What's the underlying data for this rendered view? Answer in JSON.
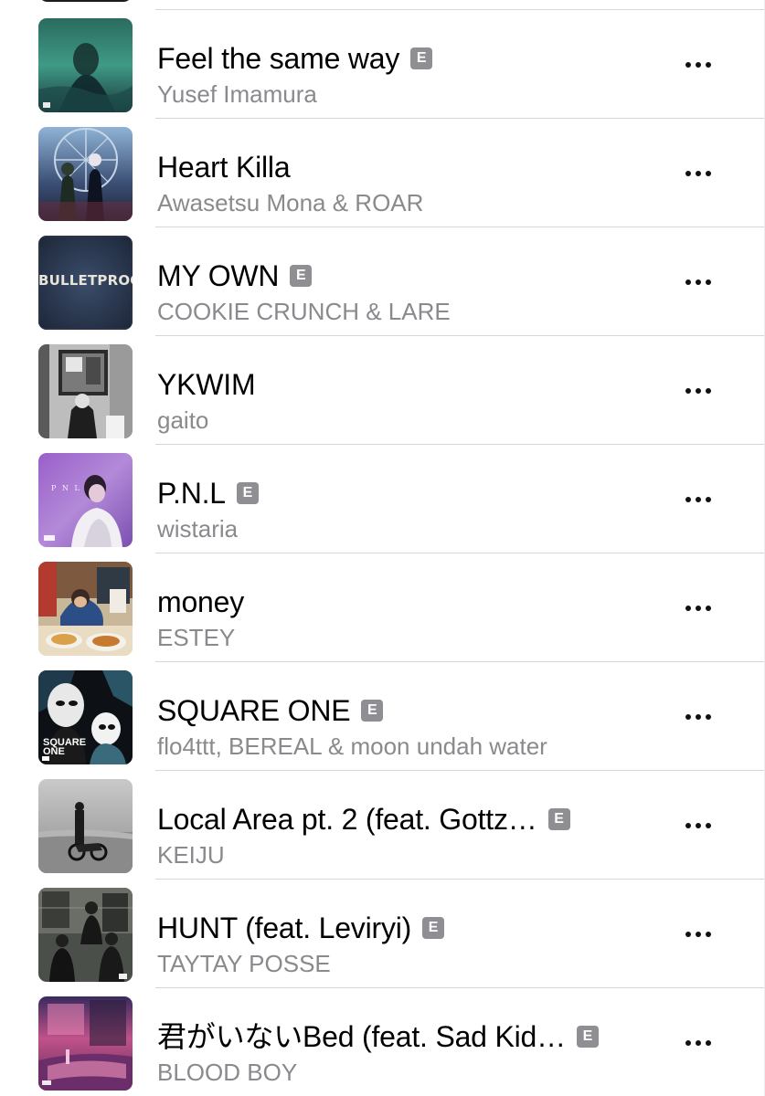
{
  "explicit_badge": "E",
  "songs": [
    {
      "title": "Feel the same way",
      "artist": "Yusef Imamura",
      "explicit": true,
      "artwork": "teal-night-portrait"
    },
    {
      "title": "Heart Killa",
      "artist": "Awasetsu Mona & ROAR",
      "explicit": false,
      "artwork": "two-figures-ferris-wheel"
    },
    {
      "title": "MY OWN",
      "artist": "COOKIE CRUNCH & LARE",
      "explicit": true,
      "artwork": "bulletproof-cover",
      "artwork_text": "BULLETPROOF"
    },
    {
      "title": "YKWIM",
      "artist": "gaito",
      "explicit": false,
      "artwork": "monochrome-room"
    },
    {
      "title": "P.N.L",
      "artist": "wistaria",
      "explicit": true,
      "artwork": "purple-portrait",
      "artwork_text": "P N L"
    },
    {
      "title": "money",
      "artist": "ESTEY",
      "explicit": false,
      "artwork": "diner-table"
    },
    {
      "title": "SQUARE ONE",
      "artist": "flo4ttt, BEREAL & moon undah water",
      "explicit": true,
      "artwork": "masked-figures-collage",
      "artwork_text": "SQUARE ONE"
    },
    {
      "title": "Local Area pt. 2 (feat. Gottz…",
      "artist": "KEIJU",
      "explicit": true,
      "artwork": "motorbike-beach"
    },
    {
      "title": "HUNT (feat. Leviryi)",
      "artist": "TAYTAY POSSE",
      "explicit": true,
      "artwork": "street-group"
    },
    {
      "title": "君がいないBed (feat. Sad Kid…",
      "artist": "BLOOD BOY",
      "explicit": true,
      "artwork": "pink-bedroom"
    }
  ]
}
